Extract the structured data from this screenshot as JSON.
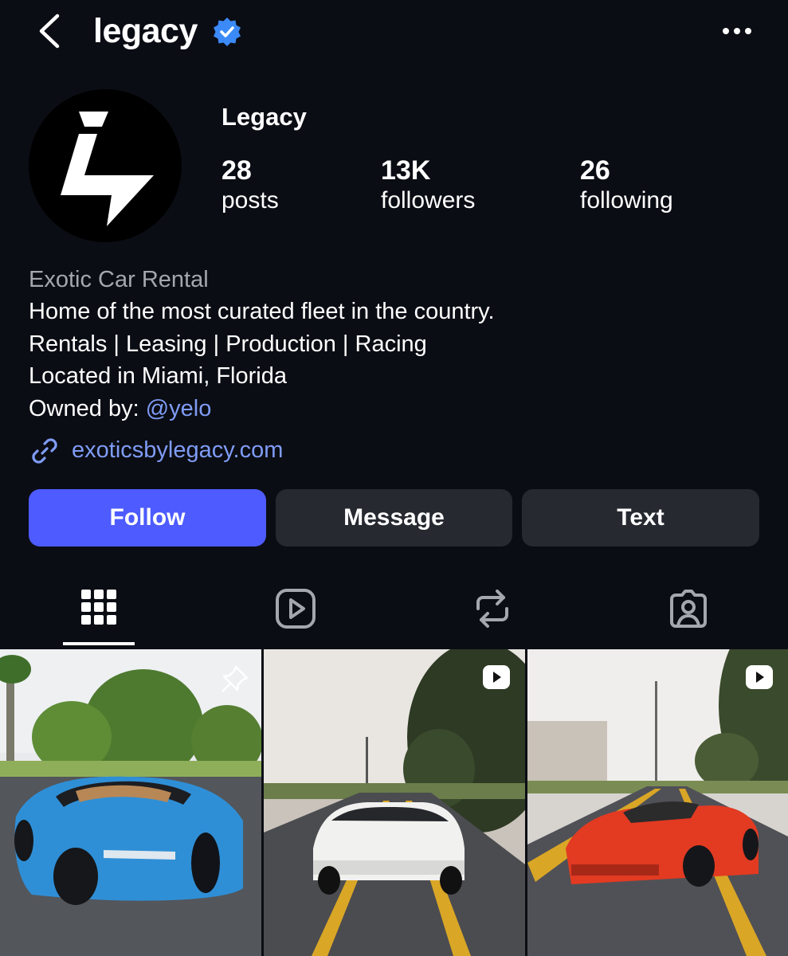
{
  "header": {
    "username": "legacy",
    "icons": [
      "chevron-left-icon",
      "verified-badge-icon",
      "more-horizontal-icon"
    ]
  },
  "profile": {
    "display_name": "Legacy",
    "stats": [
      {
        "value": "28",
        "label": "posts"
      },
      {
        "value": "13K",
        "label": "followers"
      },
      {
        "value": "26",
        "label": "following"
      }
    ]
  },
  "bio": {
    "category": "Exotic Car Rental",
    "line1": "Home of the most curated fleet in the country.",
    "line2": "Rentals | Leasing | Production | Racing",
    "line3": "Located in Miami, Florida",
    "owned_prefix": "Owned by:",
    "owned_handle": "@yelo",
    "link": "exoticsbylegacy.com"
  },
  "buttons": {
    "follow": "Follow",
    "message": "Message",
    "text": "Text"
  },
  "tabs": [
    "grid-icon",
    "reels-icon",
    "reposts-icon",
    "tagged-icon"
  ],
  "active_tab": "grid",
  "posts": [
    {
      "subject": "blue hypercar",
      "pinned": true,
      "reel": false
    },
    {
      "subject": "white suv",
      "pinned": false,
      "reel": true
    },
    {
      "subject": "red convertible",
      "pinned": false,
      "reel": true
    }
  ],
  "colors": {
    "background": "#0b0d14",
    "follow_button": "#4d5bff",
    "secondary_button": "#262930",
    "link": "#7f9cf5",
    "verified": "#3b8af7"
  }
}
